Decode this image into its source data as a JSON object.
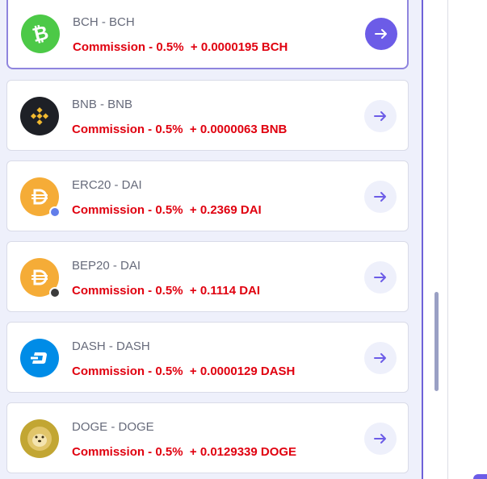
{
  "items": [
    {
      "name": "BCH - BCH",
      "commission": "Commission - 0.5%",
      "extra": "+ 0.0000195 BCH",
      "icon": "bitcoin-cash-icon",
      "color": "#4cc947",
      "selected": true
    },
    {
      "name": "BNB - BNB",
      "commission": "Commission - 0.5%",
      "extra": "+ 0.0000063 BNB",
      "icon": "binance-coin-icon",
      "color": "#1e2026"
    },
    {
      "name": "ERC20 - DAI",
      "commission": "Commission - 0.5%",
      "extra": "+ 0.2369 DAI",
      "icon": "dai-icon",
      "color": "#f5ac37",
      "badge": "ethereum-badge-icon"
    },
    {
      "name": "BEP20 - DAI",
      "commission": "Commission - 0.5%",
      "extra": "+ 0.1114 DAI",
      "icon": "dai-icon",
      "color": "#f5ac37",
      "badge": "bnb-badge-icon"
    },
    {
      "name": "DASH - DASH",
      "commission": "Commission - 0.5%",
      "extra": "+ 0.0000129 DASH",
      "icon": "dash-icon",
      "color": "#008ce7"
    },
    {
      "name": "DOGE - DOGE",
      "commission": "Commission - 0.5%",
      "extra": "+ 0.0129339 DOGE",
      "icon": "dogecoin-icon",
      "color": "#c2a633"
    }
  ],
  "accent_color": "#6c5ce7",
  "commission_color": "#e0000f",
  "arrow_icon": "arrow-right-icon"
}
